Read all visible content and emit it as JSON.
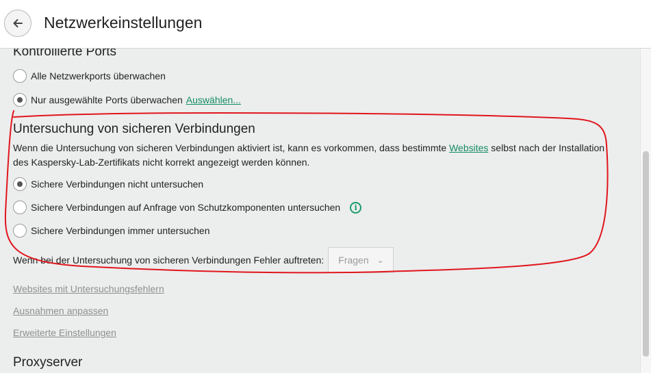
{
  "header": {
    "title": "Netzwerkeinstellungen"
  },
  "icons": {
    "back": "arrow-left-icon",
    "info": "info-icon",
    "dropdown_chevron": "chevron-down-icon"
  },
  "colors": {
    "accent_green": "#138c64",
    "annotation_red": "#e0151b"
  },
  "ports_section": {
    "title": "Kontrollierte Ports",
    "option_all": "Alle Netzwerkports überwachen",
    "option_selected": "Nur ausgewählte Ports überwachen",
    "select_link": "Auswählen...",
    "checked": "option_selected"
  },
  "secure_section": {
    "title": "Untersuchung von sicheren Verbindungen",
    "desc_part1": "Wenn die Untersuchung von sicheren Verbindungen aktiviert ist, kann es vorkommen, dass bestimmte ",
    "desc_link": "Websites",
    "desc_part2": " selbst nach der Installation des Kaspersky-Lab-Zertifikats nicht korrekt angezeigt werden können.",
    "option_none": "Sichere Verbindungen nicht untersuchen",
    "option_on_request": "Sichere Verbindungen auf Anfrage von Schutzkomponenten untersuchen",
    "option_always": "Sichere Verbindungen immer untersuchen",
    "checked": "option_none",
    "error_label": "Wenn bei der Untersuchung von sicheren Verbindungen Fehler auftreten:",
    "error_value": "Fragen"
  },
  "links": {
    "sites_errors": "Websites mit Untersuchungsfehlern",
    "exclusions": "Ausnahmen anpassen",
    "advanced": "Erweiterte Einstellungen"
  },
  "proxy_section": {
    "title": "Proxyserver"
  }
}
